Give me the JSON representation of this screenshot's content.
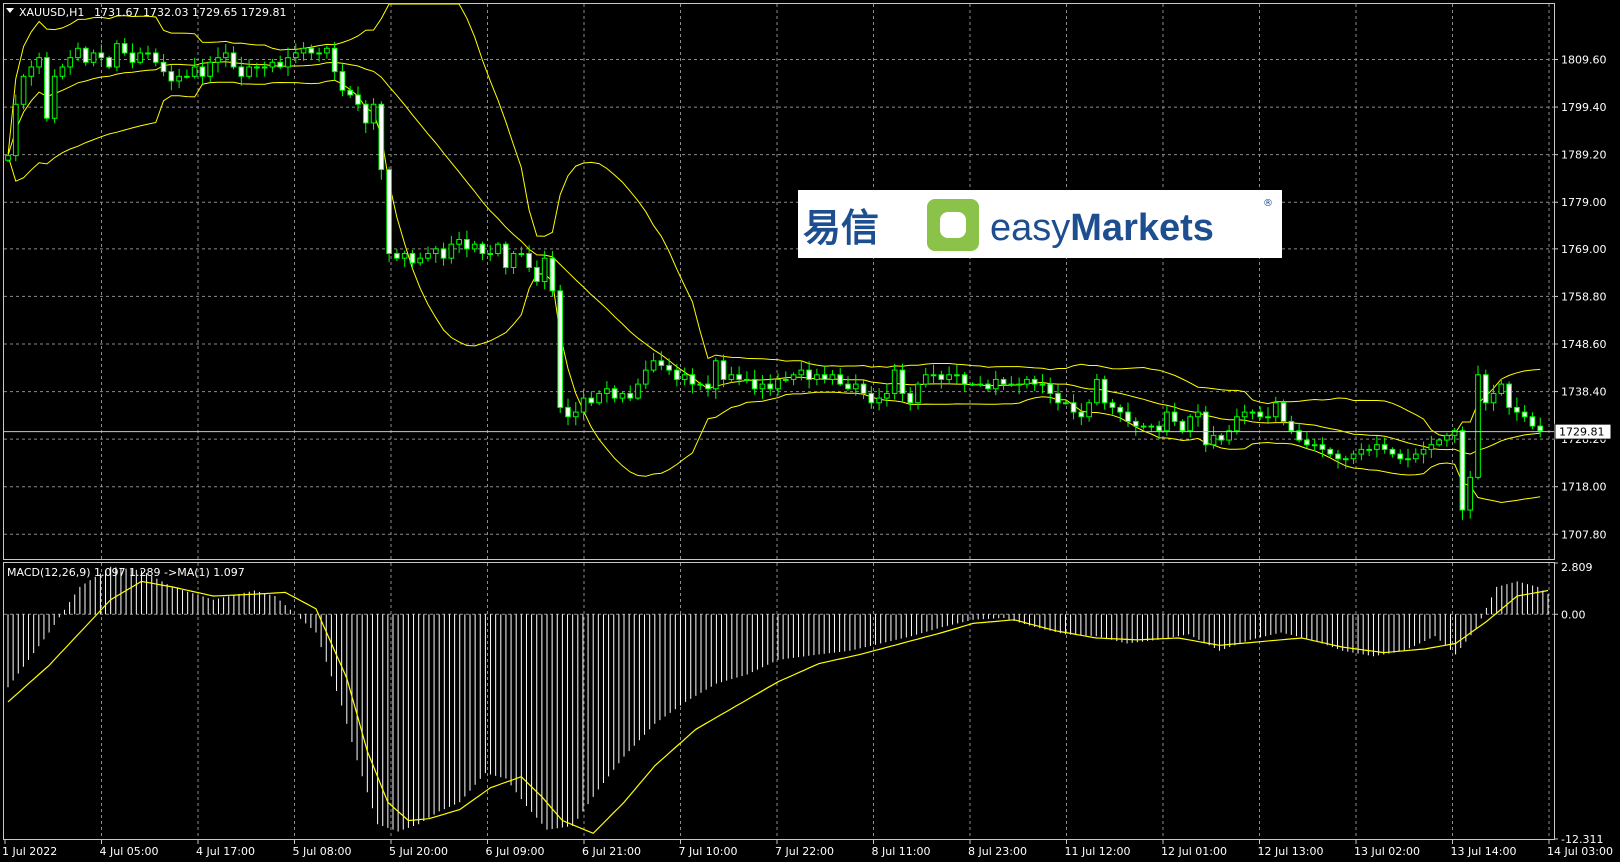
{
  "header": {
    "symbol_label": "XAUUSD,H1",
    "ohlc": "1731.67 1732.03 1729.65 1729.81"
  },
  "logo": {
    "cn": "易信",
    "en_light": "easy",
    "en_bold": "Markets",
    "reg": "®"
  },
  "colors": {
    "background": "#000000",
    "grid": "#8c8c8c",
    "bull": "#00ff00",
    "bear": "#ffffff",
    "bands": "#ffff00",
    "histogram": "#ffffff",
    "signal": "#ffff00"
  },
  "chart_data": [
    {
      "type": "candlestick",
      "title": "XAUUSD,H1",
      "indicator": "Bollinger Bands",
      "current_price": "1729.81",
      "ylim": [
        1702.5,
        1821.5
      ],
      "y_ticks": [
        "1809.60",
        "1799.40",
        "1789.20",
        "1779.00",
        "1769.00",
        "1758.80",
        "1748.60",
        "1738.40",
        "1728.20",
        "1718.00",
        "1707.80"
      ],
      "x_ticks": [
        "1 Jul 2022",
        "4 Jul 05:00",
        "4 Jul 17:00",
        "5 Jul 08:00",
        "5 Jul 20:00",
        "6 Jul 09:00",
        "6 Jul 21:00",
        "7 Jul 10:00",
        "7 Jul 22:00",
        "8 Jul 11:00",
        "8 Jul 23:00",
        "11 Jul 12:00",
        "12 Jul 01:00",
        "12 Jul 13:00",
        "13 Jul 02:00",
        "13 Jul 14:00",
        "14 Jul 03:00"
      ],
      "close_series": [
        1789,
        1800,
        1806,
        1808,
        1810,
        1797,
        1806,
        1808,
        1810,
        1812,
        1809,
        1811,
        1810,
        1808,
        1813,
        1811,
        1809,
        1811,
        1811,
        1809,
        1807,
        1805,
        1806,
        1806,
        1808,
        1806,
        1809,
        1810,
        1811,
        1808,
        1806,
        1808,
        1808,
        1808,
        1809,
        1808,
        1810,
        1811,
        1812,
        1811,
        1811,
        1812,
        1807,
        1803,
        1802,
        1800,
        1796,
        1800,
        1786,
        1768,
        1767,
        1768,
        1766,
        1767,
        1768,
        1769,
        1767,
        1770,
        1771,
        1769,
        1770,
        1768,
        1768,
        1770,
        1765,
        1768,
        1768,
        1765,
        1762,
        1767,
        1760,
        1735,
        1733,
        1734,
        1737,
        1736,
        1738,
        1739,
        1737,
        1738,
        1737,
        1740,
        1743,
        1745,
        1744,
        1743,
        1741,
        1742,
        1740,
        1740,
        1739,
        1745,
        1741,
        1742,
        1741,
        1741,
        1739,
        1740,
        1739,
        1741,
        1741,
        1742,
        1743,
        1741,
        1742,
        1741,
        1742,
        1740,
        1739,
        1740,
        1738,
        1736,
        1737,
        1738,
        1743,
        1738,
        1736,
        1740,
        1742,
        1742,
        1741,
        1742,
        1742,
        1740,
        1740,
        1740,
        1739,
        1741,
        1740,
        1740,
        1740,
        1741,
        1740,
        1740,
        1738,
        1736,
        1736,
        1734,
        1733,
        1736,
        1741,
        1736,
        1735,
        1734,
        1732,
        1731,
        1731,
        1731,
        1730,
        1734,
        1732,
        1730,
        1733,
        1734,
        1727,
        1729,
        1728,
        1730,
        1733,
        1734,
        1734,
        1733,
        1733,
        1736,
        1732,
        1730,
        1728,
        1727,
        1727,
        1726,
        1725,
        1724,
        1724,
        1725,
        1726,
        1726,
        1727,
        1726,
        1725,
        1724,
        1724,
        1725,
        1726,
        1727,
        1728,
        1729,
        1730,
        1713,
        1720,
        1742,
        1736,
        1738,
        1740,
        1735,
        1734,
        1733,
        1731,
        1730
      ]
    },
    {
      "type": "bar+line",
      "title": "MACD(12,26,9) 1.097 1.289 ->MA(1) 1.097",
      "ylim": [
        -12.311,
        2.809
      ],
      "y_ticks": [
        "2.809",
        "0.00",
        "-12.311"
      ],
      "histogram_anchors": [
        [
          0,
          -4
        ],
        [
          8,
          -1
        ],
        [
          14,
          1.5
        ],
        [
          20,
          2.6
        ],
        [
          26,
          2.4
        ],
        [
          32,
          1.5
        ],
        [
          40,
          0.8
        ],
        [
          48,
          1.3
        ],
        [
          52,
          1.0
        ],
        [
          60,
          -1.0
        ],
        [
          65,
          -5
        ],
        [
          68,
          -8
        ],
        [
          72,
          -11.5
        ],
        [
          76,
          -11.9
        ],
        [
          80,
          -11.5
        ],
        [
          84,
          -10.8
        ],
        [
          88,
          -10.3
        ],
        [
          93,
          -8.7
        ],
        [
          97,
          -9
        ],
        [
          101,
          -10.5
        ],
        [
          105,
          -11.8
        ],
        [
          110,
          -11.6
        ],
        [
          115,
          -9.6
        ],
        [
          120,
          -7.8
        ],
        [
          126,
          -6.0
        ],
        [
          132,
          -4.8
        ],
        [
          138,
          -3.8
        ],
        [
          144,
          -3.3
        ],
        [
          150,
          -2.5
        ],
        [
          158,
          -2.2
        ],
        [
          164,
          -2.0
        ],
        [
          170,
          -1.6
        ],
        [
          176,
          -1.2
        ],
        [
          182,
          -0.7
        ],
        [
          188,
          -0.3
        ],
        [
          194,
          -0.2
        ],
        [
          200,
          -0.7
        ],
        [
          206,
          -1.1
        ],
        [
          212,
          -1.2
        ],
        [
          218,
          -1.6
        ],
        [
          224,
          -1.4
        ],
        [
          230,
          -1.1
        ],
        [
          236,
          -2.0
        ],
        [
          242,
          -1.4
        ],
        [
          248,
          -1.0
        ],
        [
          254,
          -1.4
        ],
        [
          260,
          -2.0
        ],
        [
          266,
          -2.3
        ],
        [
          272,
          -2.0
        ],
        [
          278,
          -1.2
        ],
        [
          282,
          -2.2
        ],
        [
          286,
          -0.8
        ],
        [
          290,
          1.5
        ],
        [
          294,
          1.8
        ],
        [
          298,
          1.5
        ],
        [
          300,
          1.1
        ]
      ],
      "signal_anchors": [
        [
          0,
          -4.8
        ],
        [
          8,
          -2.8
        ],
        [
          14,
          -1.0
        ],
        [
          20,
          0.8
        ],
        [
          26,
          1.8
        ],
        [
          32,
          1.5
        ],
        [
          40,
          1.0
        ],
        [
          48,
          1.1
        ],
        [
          54,
          1.2
        ],
        [
          60,
          0.3
        ],
        [
          66,
          -3.5
        ],
        [
          70,
          -7.5
        ],
        [
          74,
          -10.3
        ],
        [
          78,
          -11.3
        ],
        [
          82,
          -11.2
        ],
        [
          88,
          -10.7
        ],
        [
          94,
          -9.5
        ],
        [
          100,
          -8.9
        ],
        [
          104,
          -10.0
        ],
        [
          108,
          -11.3
        ],
        [
          114,
          -12.0
        ],
        [
          120,
          -10.3
        ],
        [
          126,
          -8.3
        ],
        [
          134,
          -6.3
        ],
        [
          142,
          -5.0
        ],
        [
          150,
          -3.7
        ],
        [
          158,
          -2.7
        ],
        [
          166,
          -2.2
        ],
        [
          174,
          -1.6
        ],
        [
          182,
          -1.0
        ],
        [
          188,
          -0.5
        ],
        [
          196,
          -0.3
        ],
        [
          204,
          -0.9
        ],
        [
          212,
          -1.3
        ],
        [
          220,
          -1.4
        ],
        [
          228,
          -1.3
        ],
        [
          236,
          -1.7
        ],
        [
          244,
          -1.5
        ],
        [
          252,
          -1.3
        ],
        [
          260,
          -1.8
        ],
        [
          268,
          -2.1
        ],
        [
          276,
          -1.9
        ],
        [
          282,
          -1.6
        ],
        [
          288,
          -0.4
        ],
        [
          294,
          1.0
        ],
        [
          300,
          1.3
        ]
      ]
    }
  ]
}
